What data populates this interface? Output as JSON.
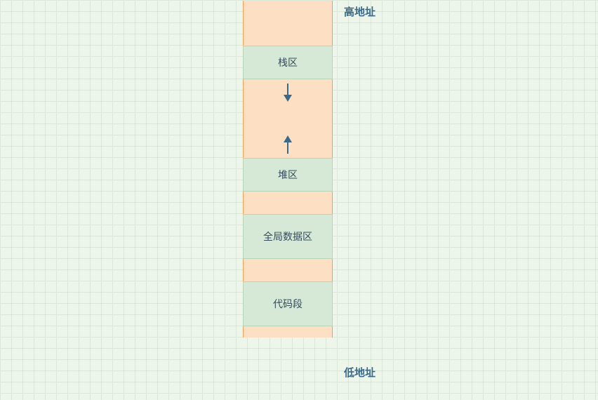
{
  "labels": {
    "high_address": "高地址",
    "low_address": "低地址"
  },
  "segments": {
    "stack": "栈区",
    "heap": "堆区",
    "global_data": "全局数据区",
    "code": "代码段"
  }
}
